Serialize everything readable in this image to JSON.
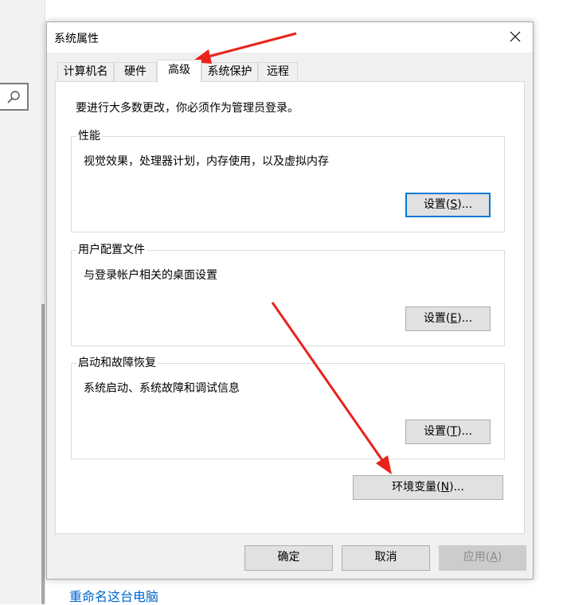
{
  "background": {
    "link_text": "重命名这台电脑"
  },
  "dialog": {
    "title": "系统属性",
    "tabs": [
      "计算机名",
      "硬件",
      "高级",
      "系统保护",
      "远程"
    ],
    "active_tab": "高级",
    "intro": "要进行大多数更改，你必须作为管理员登录。",
    "groups": [
      {
        "title": "性能",
        "desc": "视觉效果，处理器计划，内存使用，以及虚拟内存",
        "button": {
          "pre": "设置(",
          "key": "S",
          "post": ")..."
        }
      },
      {
        "title": "用户配置文件",
        "desc": "与登录帐户相关的桌面设置",
        "button": {
          "pre": "设置(",
          "key": "E",
          "post": ")..."
        }
      },
      {
        "title": "启动和故障恢复",
        "desc": "系统启动、系统故障和调试信息",
        "button": {
          "pre": "设置(",
          "key": "T",
          "post": ")..."
        }
      }
    ],
    "env_button": {
      "pre": "环境变量(",
      "key": "N",
      "post": ")..."
    },
    "footer": {
      "ok": "确定",
      "cancel": "取消",
      "apply": {
        "pre": "应用(",
        "key": "A",
        "post": ")"
      }
    }
  },
  "colors": {
    "annotation_arrow": "#e8231b",
    "focus_border": "#0078d7",
    "link": "#0066cc"
  },
  "icons": [
    "search-icon",
    "close-icon"
  ]
}
